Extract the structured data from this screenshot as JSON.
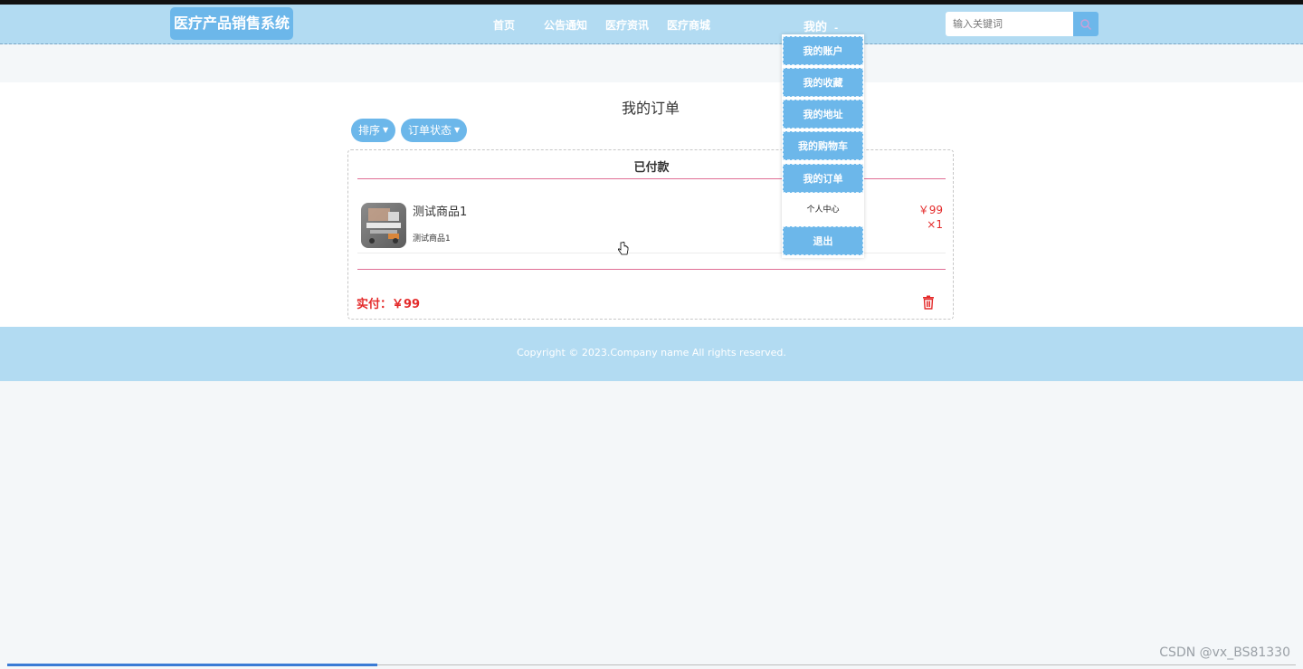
{
  "header": {
    "brand": "医疗产品销售系统",
    "nav": [
      "首页",
      "公告通知",
      "医疗资讯",
      "医疗商城"
    ],
    "user_menu_label": "我的",
    "search_placeholder": "输入关键词"
  },
  "user_dropdown": {
    "items": [
      "我的账户",
      "我的收藏",
      "我的地址",
      "我的购物车",
      "我的订单"
    ],
    "plain_item": "个人中心",
    "logout": "退出"
  },
  "page": {
    "title": "我的订单",
    "filters": [
      "排序",
      "订单状态"
    ]
  },
  "order": {
    "status": "已付款",
    "product_name": "测试商品1",
    "product_sub": "测试商品1",
    "price": "￥99",
    "quantity": "×1",
    "paid_label": "实付：",
    "paid_amount": "￥99"
  },
  "footer": {
    "copyright": "Copyright © 2023.Company name All rights reserved."
  },
  "watermark": "CSDN @vx_BS81330",
  "colors": {
    "header_bg": "#b2dbf2",
    "accent": "#6cb7ea",
    "price_red": "#e42b2b",
    "divider_pink": "#e06e95"
  },
  "icons": [
    "search-icon",
    "chevron-down-icon",
    "trash-icon",
    "pointer-cursor-icon"
  ]
}
